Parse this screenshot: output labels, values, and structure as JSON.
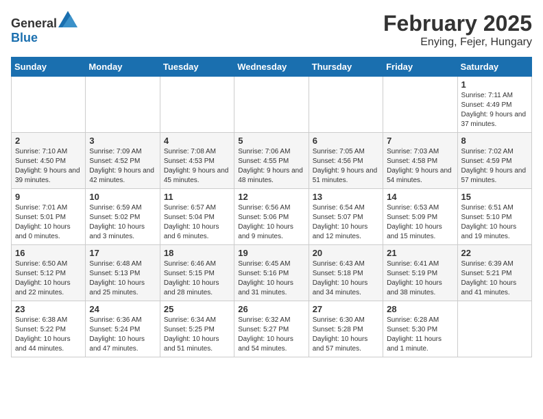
{
  "header": {
    "logo_general": "General",
    "logo_blue": "Blue",
    "month_title": "February 2025",
    "location": "Enying, Fejer, Hungary"
  },
  "days_of_week": [
    "Sunday",
    "Monday",
    "Tuesday",
    "Wednesday",
    "Thursday",
    "Friday",
    "Saturday"
  ],
  "weeks": [
    [
      {
        "day": "",
        "info": ""
      },
      {
        "day": "",
        "info": ""
      },
      {
        "day": "",
        "info": ""
      },
      {
        "day": "",
        "info": ""
      },
      {
        "day": "",
        "info": ""
      },
      {
        "day": "",
        "info": ""
      },
      {
        "day": "1",
        "info": "Sunrise: 7:11 AM\nSunset: 4:49 PM\nDaylight: 9 hours and 37 minutes."
      }
    ],
    [
      {
        "day": "2",
        "info": "Sunrise: 7:10 AM\nSunset: 4:50 PM\nDaylight: 9 hours and 39 minutes."
      },
      {
        "day": "3",
        "info": "Sunrise: 7:09 AM\nSunset: 4:52 PM\nDaylight: 9 hours and 42 minutes."
      },
      {
        "day": "4",
        "info": "Sunrise: 7:08 AM\nSunset: 4:53 PM\nDaylight: 9 hours and 45 minutes."
      },
      {
        "day": "5",
        "info": "Sunrise: 7:06 AM\nSunset: 4:55 PM\nDaylight: 9 hours and 48 minutes."
      },
      {
        "day": "6",
        "info": "Sunrise: 7:05 AM\nSunset: 4:56 PM\nDaylight: 9 hours and 51 minutes."
      },
      {
        "day": "7",
        "info": "Sunrise: 7:03 AM\nSunset: 4:58 PM\nDaylight: 9 hours and 54 minutes."
      },
      {
        "day": "8",
        "info": "Sunrise: 7:02 AM\nSunset: 4:59 PM\nDaylight: 9 hours and 57 minutes."
      }
    ],
    [
      {
        "day": "9",
        "info": "Sunrise: 7:01 AM\nSunset: 5:01 PM\nDaylight: 10 hours and 0 minutes."
      },
      {
        "day": "10",
        "info": "Sunrise: 6:59 AM\nSunset: 5:02 PM\nDaylight: 10 hours and 3 minutes."
      },
      {
        "day": "11",
        "info": "Sunrise: 6:57 AM\nSunset: 5:04 PM\nDaylight: 10 hours and 6 minutes."
      },
      {
        "day": "12",
        "info": "Sunrise: 6:56 AM\nSunset: 5:06 PM\nDaylight: 10 hours and 9 minutes."
      },
      {
        "day": "13",
        "info": "Sunrise: 6:54 AM\nSunset: 5:07 PM\nDaylight: 10 hours and 12 minutes."
      },
      {
        "day": "14",
        "info": "Sunrise: 6:53 AM\nSunset: 5:09 PM\nDaylight: 10 hours and 15 minutes."
      },
      {
        "day": "15",
        "info": "Sunrise: 6:51 AM\nSunset: 5:10 PM\nDaylight: 10 hours and 19 minutes."
      }
    ],
    [
      {
        "day": "16",
        "info": "Sunrise: 6:50 AM\nSunset: 5:12 PM\nDaylight: 10 hours and 22 minutes."
      },
      {
        "day": "17",
        "info": "Sunrise: 6:48 AM\nSunset: 5:13 PM\nDaylight: 10 hours and 25 minutes."
      },
      {
        "day": "18",
        "info": "Sunrise: 6:46 AM\nSunset: 5:15 PM\nDaylight: 10 hours and 28 minutes."
      },
      {
        "day": "19",
        "info": "Sunrise: 6:45 AM\nSunset: 5:16 PM\nDaylight: 10 hours and 31 minutes."
      },
      {
        "day": "20",
        "info": "Sunrise: 6:43 AM\nSunset: 5:18 PM\nDaylight: 10 hours and 34 minutes."
      },
      {
        "day": "21",
        "info": "Sunrise: 6:41 AM\nSunset: 5:19 PM\nDaylight: 10 hours and 38 minutes."
      },
      {
        "day": "22",
        "info": "Sunrise: 6:39 AM\nSunset: 5:21 PM\nDaylight: 10 hours and 41 minutes."
      }
    ],
    [
      {
        "day": "23",
        "info": "Sunrise: 6:38 AM\nSunset: 5:22 PM\nDaylight: 10 hours and 44 minutes."
      },
      {
        "day": "24",
        "info": "Sunrise: 6:36 AM\nSunset: 5:24 PM\nDaylight: 10 hours and 47 minutes."
      },
      {
        "day": "25",
        "info": "Sunrise: 6:34 AM\nSunset: 5:25 PM\nDaylight: 10 hours and 51 minutes."
      },
      {
        "day": "26",
        "info": "Sunrise: 6:32 AM\nSunset: 5:27 PM\nDaylight: 10 hours and 54 minutes."
      },
      {
        "day": "27",
        "info": "Sunrise: 6:30 AM\nSunset: 5:28 PM\nDaylight: 10 hours and 57 minutes."
      },
      {
        "day": "28",
        "info": "Sunrise: 6:28 AM\nSunset: 5:30 PM\nDaylight: 11 hours and 1 minute."
      },
      {
        "day": "",
        "info": ""
      }
    ]
  ]
}
